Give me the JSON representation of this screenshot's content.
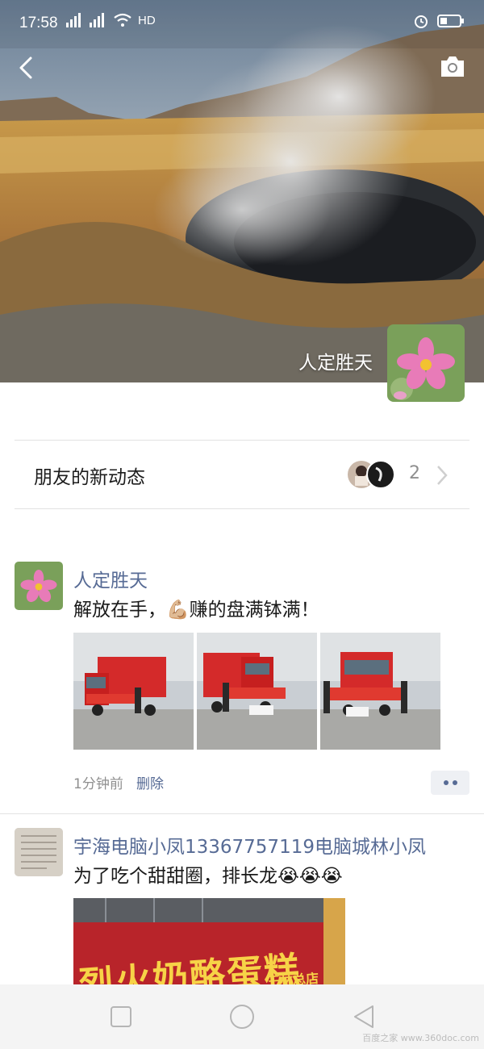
{
  "status_bar": {
    "time": "17:58",
    "hd_label": "HD"
  },
  "profile": {
    "name": "人定胜天"
  },
  "moments_bar": {
    "label": "朋友的新动态",
    "count": "2"
  },
  "posts": [
    {
      "author": "人定胜天",
      "text": "解放在手，💪🏼赚的盘满钵满！",
      "time": "1分钟前",
      "delete_label": "删除",
      "photo_count": 3
    },
    {
      "author": "宇海电脑小凤13367757119电脑城林小凤",
      "text": "为了吃个甜甜圈，排长龙😭😭😭",
      "image_sign_text": "烈火奶酪蛋糕",
      "image_sign_sub": "王林总店"
    }
  ],
  "icons": {
    "back": "back-arrow-icon",
    "camera": "camera-icon",
    "chevron": "chevron-right-icon",
    "nav": [
      "square-recent-icon",
      "circle-home-icon",
      "triangle-back-icon"
    ]
  },
  "watermark": "百度之家 www.360doc.com",
  "colors": {
    "link": "#576b95",
    "meta": "#8f8f8f",
    "truck_red": "#d42a2a"
  }
}
